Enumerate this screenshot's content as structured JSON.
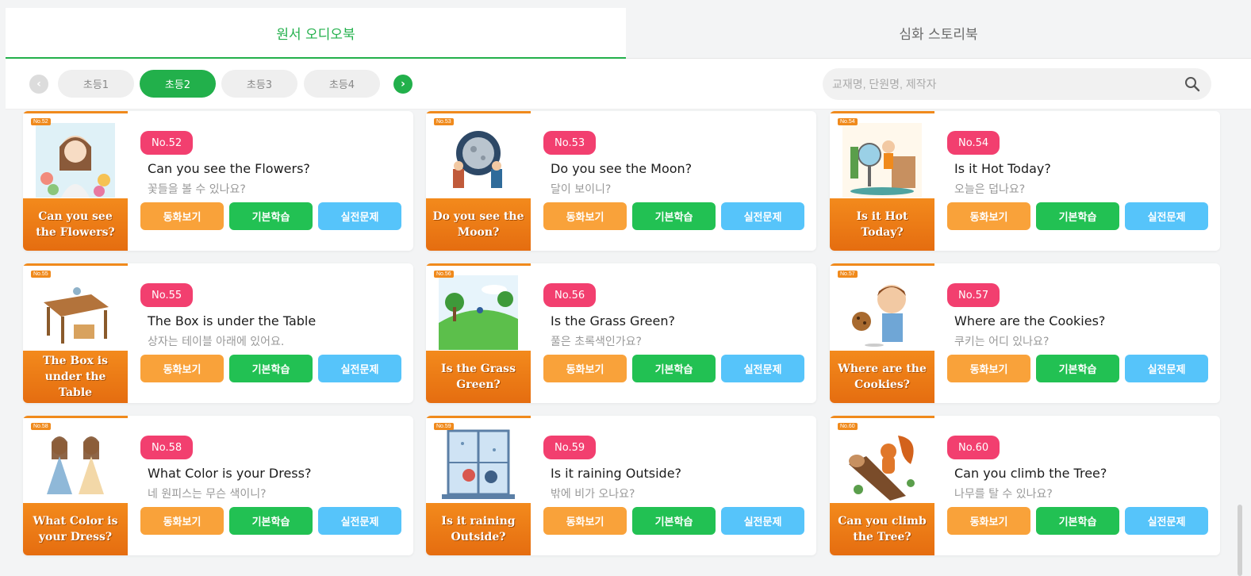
{
  "tabs": [
    {
      "label": "원서 오디오북",
      "active": true
    },
    {
      "label": "심화 스토리북",
      "active": false
    }
  ],
  "grades": [
    {
      "label": "초등1",
      "active": false
    },
    {
      "label": "초등2",
      "active": true
    },
    {
      "label": "초등3",
      "active": false
    },
    {
      "label": "초등4",
      "active": false
    }
  ],
  "nav": {
    "prev_icon": "chevron-left-icon",
    "next_icon": "chevron-right-icon"
  },
  "search": {
    "placeholder": "교재명, 단원명, 제작자",
    "icon": "search-icon"
  },
  "buttons": {
    "story": "동화보기",
    "basic": "기본학습",
    "test": "실전문제"
  },
  "colors": {
    "brand_green": "#22b04b",
    "badge_pink": "#f23f6f",
    "story_orange": "#f9a23a",
    "basic_green": "#22c153",
    "test_blue": "#56c4fa",
    "cover_orange": "#f08a1c"
  },
  "books": [
    {
      "no": "No.52",
      "title": "Can you see the Flowers?",
      "subtitle": "꽃들을 볼 수 있나요?",
      "cover_title": "Can you see the Flowers?",
      "cover_badge": "No.52",
      "art": "girl-with-flowers"
    },
    {
      "no": "No.53",
      "title": "Do you see the Moon?",
      "subtitle": "달이 보이니?",
      "cover_title": "Do you see the Moon?",
      "cover_badge": "No.53",
      "art": "kids-and-moon"
    },
    {
      "no": "No.54",
      "title": "Is it Hot Today?",
      "subtitle": "오늘은 덥나요?",
      "cover_title": "Is it Hot Today?",
      "cover_badge": "No.54",
      "art": "boy-with-fan"
    },
    {
      "no": "No.55",
      "title": "The Box is under the Table",
      "subtitle": "상자는 테이블 아래에 있어요.",
      "cover_title": "The Box is under the Table",
      "cover_badge": "No.55",
      "art": "table-and-box"
    },
    {
      "no": "No.56",
      "title": "Is the Grass Green?",
      "subtitle": "풀은 초록색인가요?",
      "cover_title": "Is the Grass Green?",
      "cover_badge": "No.56",
      "art": "green-hill"
    },
    {
      "no": "No.57",
      "title": "Where are the Cookies?",
      "subtitle": "쿠키는 어디 있나요?",
      "cover_title": "Where are the Cookies?",
      "cover_badge": "No.57",
      "art": "boy-with-cookie"
    },
    {
      "no": "No.58",
      "title": "What Color is your Dress?",
      "subtitle": "네 원피스는 무슨 색이니?",
      "cover_title": "What Color is your Dress?",
      "cover_badge": "No.58",
      "art": "two-girls-dresses"
    },
    {
      "no": "No.59",
      "title": "Is it raining Outside?",
      "subtitle": "밖에 비가 오나요?",
      "cover_title": "Is it raining Outside?",
      "cover_badge": "No.59",
      "art": "rainy-window"
    },
    {
      "no": "No.60",
      "title": "Can you climb the Tree?",
      "subtitle": "나무를 탈 수 있나요?",
      "cover_title": "Can you climb the Tree?",
      "cover_badge": "No.60",
      "art": "squirrel-on-log"
    }
  ]
}
